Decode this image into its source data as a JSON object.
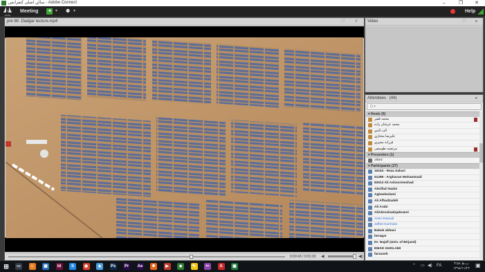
{
  "window": {
    "title": "سالن اصلی کنفرانس - Adobe Connect",
    "minimize": "–",
    "maximize": "❐",
    "close": "✕"
  },
  "menubar": {
    "logo_text": "Adobe",
    "meeting_label": "Meeting",
    "help_label": "Help",
    "chevron": "▾",
    "speaker_glyph": "◄",
    "camera_glyph": "⚉"
  },
  "share_pod": {
    "title": "pre Mr. Dadgar lecture.mp4",
    "fullscreen_glyph": "⛶",
    "menu_glyph": "≡",
    "time_display": "0:00:43 / 0:01:03",
    "progress": 0.66,
    "volume": 0.95,
    "speaker_glyph": "◀",
    "speaker_full_glyph": "◀)"
  },
  "video_pod": {
    "title": "Video",
    "fullscreen_glyph": "⛶",
    "menu_glyph": "▸"
  },
  "attendees_pod": {
    "title": "Attendees",
    "count": "(44)",
    "menu_glyph": "▸",
    "search_placeholder": "Q ▾",
    "hosts_label": "Hosts (6)",
    "presenters_label": "Presenters (1)",
    "participants_label": "Participants (37)",
    "hosts": [
      {
        "name": "محمد فقير",
        "flag": true
      },
      {
        "name": "محمد عرشان زاده",
        "flag": false
      },
      {
        "name": "الت الدي",
        "flag": false
      },
      {
        "name": "عليرضا مختاري",
        "flag": false
      },
      {
        "name": "فرزانه مجيري",
        "flag": false
      },
      {
        "name": "مرتضیه طوسفی",
        "flag": true
      }
    ],
    "presenters": [
      {
        "name": "orbez"
      }
    ],
    "participants": [
      {
        "name": "16153 - Reza Sahari",
        "style": "bold"
      },
      {
        "name": "51289 - Arghavan Mohammadi",
        "style": "bold"
      },
      {
        "name": "83513 Ali Ashoormeshad",
        "style": "bold"
      },
      {
        "name": "Abolfazl Nadai",
        "style": "bold"
      },
      {
        "name": "Agheeleslami",
        "style": "bold"
      },
      {
        "name": "Ali Afhadzadeh",
        "style": "bold"
      },
      {
        "name": "Ali Arabi",
        "style": "bold"
      },
      {
        "name": "AliAbroshadnjabraeni",
        "style": "bold"
      },
      {
        "name": "Amin Rasouli",
        "style": "blue"
      },
      {
        "name": "Jaffari Karimian",
        "style": "blue"
      },
      {
        "name": "Babak abbasi",
        "style": "bold"
      },
      {
        "name": "beragar",
        "style": "bold"
      },
      {
        "name": "Dr. Najafi (Univ. of Birjand)",
        "style": "bold"
      },
      {
        "name": "EMAD GHOLAMI",
        "style": "bold"
      },
      {
        "name": "farzaneh",
        "style": "bold"
      }
    ]
  },
  "taskbar": {
    "start_glyph": "⊞",
    "clock_time": "۴:۵۸ ب.ظ",
    "clock_date": "۱۳۹۸/۱۱/۲۲",
    "lang": "FA",
    "notification_glyph": "▣",
    "apps": [
      {
        "icon": "task-view-icon",
        "glyph": "▭",
        "color": "#333a44"
      },
      {
        "icon": "hand-app-icon",
        "glyph": "☺",
        "color": "#e67e22"
      },
      {
        "icon": "files-app-icon",
        "glyph": "▦",
        "color": "#2c6fbf"
      },
      {
        "icon": "indesign-icon",
        "glyph": "Id",
        "color": "#6b0f3a"
      },
      {
        "icon": "skype-icon",
        "glyph": "S",
        "color": "#1e88e5"
      },
      {
        "icon": "chrome-icon",
        "glyph": "◉",
        "color": "#d9432b"
      },
      {
        "icon": "maps-app-icon",
        "glyph": "◈",
        "color": "#4a9fe0"
      },
      {
        "icon": "photoshop-icon",
        "glyph": "Ps",
        "color": "#0d2b4d"
      },
      {
        "icon": "premiere-icon",
        "glyph": "Pr",
        "color": "#2a0a4a"
      },
      {
        "icon": "after-effects-icon",
        "glyph": "Ae",
        "color": "#2a0a4a"
      },
      {
        "icon": "firefox-icon",
        "glyph": "✹",
        "color": "#e8641b"
      },
      {
        "icon": "media-player-icon",
        "glyph": "▶",
        "color": "#c0392b"
      },
      {
        "icon": "camtasia-icon",
        "glyph": "◆",
        "color": "#2e7d32"
      },
      {
        "icon": "sticky-notes-icon",
        "glyph": "✎",
        "color": "#f3c614"
      },
      {
        "icon": "snip-tool-icon",
        "glyph": "✂",
        "color": "#8e44ad"
      },
      {
        "icon": "acrobat-icon",
        "glyph": "A",
        "color": "#c62828"
      },
      {
        "icon": "adobe-connect-icon",
        "glyph": "▣",
        "color": "#1f7a3d"
      }
    ]
  }
}
